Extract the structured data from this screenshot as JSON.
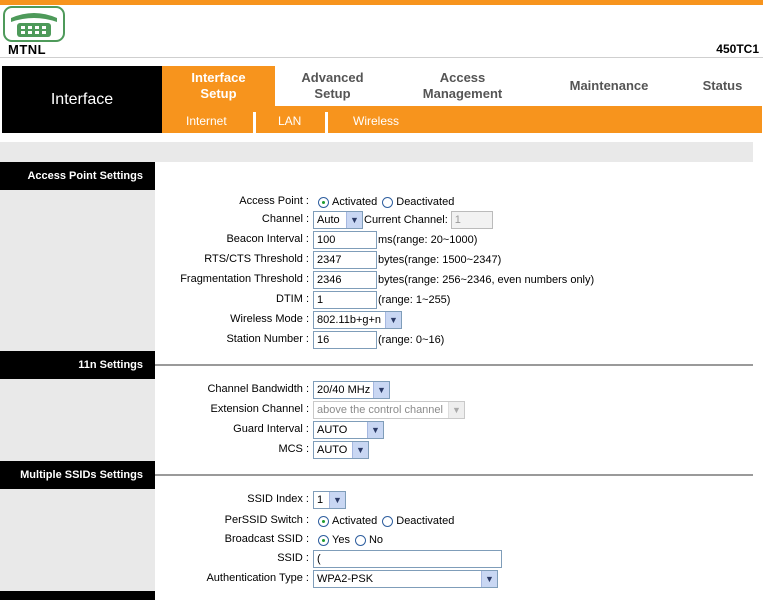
{
  "brand": {
    "name": "MTNL",
    "model": "450TC1"
  },
  "section_title": "Interface",
  "nav": {
    "tabs": [
      {
        "label_l1": "Interface",
        "label_l2": "Setup",
        "active": true
      },
      {
        "label_l1": "Advanced",
        "label_l2": "Setup",
        "active": false
      },
      {
        "label_l1": "Access",
        "label_l2": "Management",
        "active": false
      },
      {
        "label_l1": "Maintenance",
        "label_l2": "",
        "active": false
      },
      {
        "label_l1": "Status",
        "label_l2": "",
        "active": false
      }
    ],
    "subtabs": [
      "Internet",
      "LAN",
      "Wireless"
    ]
  },
  "colors": {
    "accent": "#f7941d",
    "header_black": "#000000",
    "panel_grey": "#e9e9e9"
  },
  "sections": {
    "ap": "Access Point Settings",
    "n11": "11n Settings",
    "ssid": "Multiple SSIDs Settings"
  },
  "ap": {
    "access_point": {
      "label": "Access Point :",
      "opt1": "Activated",
      "opt2": "Deactivated",
      "selected": "Activated"
    },
    "channel": {
      "label": "Channel :",
      "value": "Auto",
      "current_label": "Current Channel:",
      "current_value": "1"
    },
    "beacon": {
      "label": "Beacon Interval :",
      "value": "100",
      "note": "ms(range: 20~1000)"
    },
    "rts": {
      "label": "RTS/CTS Threshold :",
      "value": "2347",
      "note": "bytes(range: 1500~2347)"
    },
    "frag": {
      "label": "Fragmentation Threshold :",
      "value": "2346",
      "note": "bytes(range: 256~2346, even numbers only)"
    },
    "dtim": {
      "label": "DTIM :",
      "value": "1",
      "note": "(range: 1~255)"
    },
    "mode": {
      "label": "Wireless Mode :",
      "value": "802.11b+g+n"
    },
    "station": {
      "label": "Station Number :",
      "value": "16",
      "note": "(range: 0~16)"
    }
  },
  "n11": {
    "bandwidth": {
      "label": "Channel Bandwidth :",
      "value": "20/40 MHz"
    },
    "extension": {
      "label": "Extension Channel :",
      "value": "above the control channel"
    },
    "guard": {
      "label": "Guard Interval :",
      "value": "AUTO"
    },
    "mcs": {
      "label": "MCS :",
      "value": "AUTO"
    }
  },
  "ssid": {
    "index": {
      "label": "SSID Index :",
      "value": "1"
    },
    "switch": {
      "label": "PerSSID Switch :",
      "opt1": "Activated",
      "opt2": "Deactivated",
      "selected": "Activated"
    },
    "broadcast": {
      "label": "Broadcast SSID :",
      "opt1": "Yes",
      "opt2": "No",
      "selected": "Yes"
    },
    "name": {
      "label": "SSID :",
      "value": "("
    },
    "auth": {
      "label": "Authentication Type :",
      "value": "WPA2-PSK"
    }
  }
}
